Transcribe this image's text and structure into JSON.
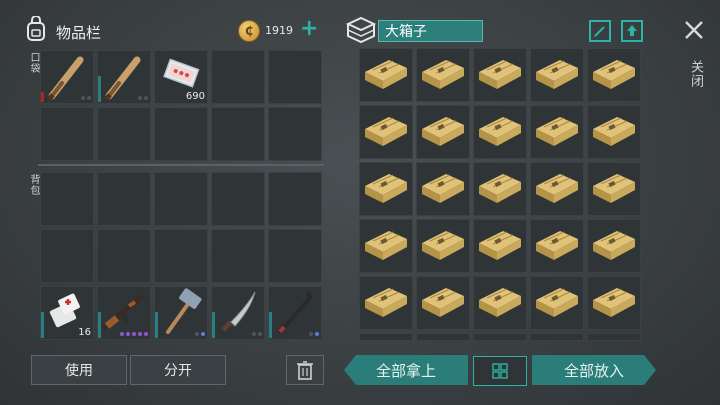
{
  "inventory": {
    "title": "物品栏",
    "pockets_label": "口袋",
    "backpack_label": "背包",
    "gold": "1919"
  },
  "pocket_items": [
    {
      "name": "baseball-bat-icon",
      "bar": "red",
      "qty": "",
      "dots": 2
    },
    {
      "name": "baseball-bat-icon",
      "bar": "teal",
      "qty": "",
      "dots": 2
    },
    {
      "name": "bandage-pack-icon",
      "bar": "",
      "qty": "690",
      "dots": 0
    }
  ],
  "hotbar_items": [
    {
      "name": "medkit-icon",
      "qty": "16"
    },
    {
      "name": "assault-rifle-icon",
      "dots": "purple"
    },
    {
      "name": "sledgehammer-icon",
      "dots": "blue"
    },
    {
      "name": "machete-icon",
      "dots": "grey"
    },
    {
      "name": "crowbar-icon",
      "dots": "blue"
    }
  ],
  "container": {
    "name": "大箱子",
    "close_label": "关闭",
    "item": "crate-plank-icon"
  },
  "buttons": {
    "use": "使用",
    "split": "分开",
    "take_all": "全部拿上",
    "put_all": "全部放入"
  },
  "colors": {
    "accent": "#2bb3a5",
    "slot": "#2f3436",
    "durability": "#2a7f80"
  }
}
